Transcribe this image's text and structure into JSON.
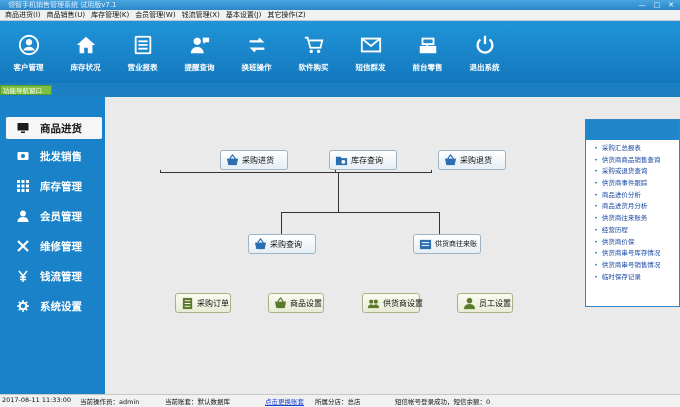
{
  "window": {
    "title": "领智手机销售管理系统 试用版v7.1",
    "controls": [
      "—",
      "□",
      "✕"
    ]
  },
  "menu": [
    "商品进货(I)",
    "商品销售(U)",
    "库存管理(K)",
    "会员管理(W)",
    "钱流管理(X)",
    "基本设置(J)",
    "其它操作(Z)"
  ],
  "toolbar": [
    {
      "label": "客户管理",
      "icon": "user-circle-icon"
    },
    {
      "label": "库存状况",
      "icon": "house-icon"
    },
    {
      "label": "营业报表",
      "icon": "report-icon"
    },
    {
      "label": "提醒查询",
      "icon": "person-chat-icon"
    },
    {
      "label": "换班操作",
      "icon": "swap-arrows-icon"
    },
    {
      "label": "软件购买",
      "icon": "cart-icon"
    },
    {
      "label": "短信群发",
      "icon": "message-icon"
    },
    {
      "label": "前台零售",
      "icon": "cash-register-icon"
    },
    {
      "label": "退出系统",
      "icon": "power-icon"
    }
  ],
  "nav_tag": "功能导航窗口",
  "sidebar": [
    {
      "label": "商品进货",
      "icon": "monitor-icon",
      "active": true
    },
    {
      "label": "批发销售",
      "icon": "money-icon",
      "active": false
    },
    {
      "label": "库存管理",
      "icon": "grid-icon",
      "active": false
    },
    {
      "label": "会员管理",
      "icon": "person-icon",
      "active": false
    },
    {
      "label": "维修管理",
      "icon": "tools-icon",
      "active": false
    },
    {
      "label": "钱流管理",
      "icon": "yen-icon",
      "active": false
    },
    {
      "label": "系统设置",
      "icon": "gear-icon",
      "active": false
    }
  ],
  "flow": {
    "purchase_in": "采购进货",
    "stock_query": "库存查询",
    "purchase_return": "采购退货",
    "purchase_query": "采购查询",
    "supplier_account": "供货商往来账",
    "purchase_order": "采购订单",
    "product_settings": "商品设置",
    "supplier_settings": "供货商设置",
    "staff_settings": "员工设置"
  },
  "reports": [
    "采购汇总报表",
    "供货商商品销售查询",
    "采购或退货查询",
    "供货商事件跟踪",
    "商品进价分析",
    "商品进货月分析",
    "供货商往来账务",
    "经营历程",
    "供货商价保",
    "供货商串号库存情况",
    "供货商串号销售情况",
    "临时保存记录"
  ],
  "status": {
    "datetime": "2017-08-11 11:33:00",
    "operator": "当前操作员：admin",
    "account": "当前账套：默认数据库",
    "link": "点击更换账套",
    "branch": "所属分店：总店",
    "sync": "短信帐号登录成功，短信余额：0"
  },
  "colors": {
    "toolbar": "#1a88d0",
    "sidebar": "#1a82c8",
    "nav_tag": "#7dc142",
    "link": "#1646a0"
  }
}
